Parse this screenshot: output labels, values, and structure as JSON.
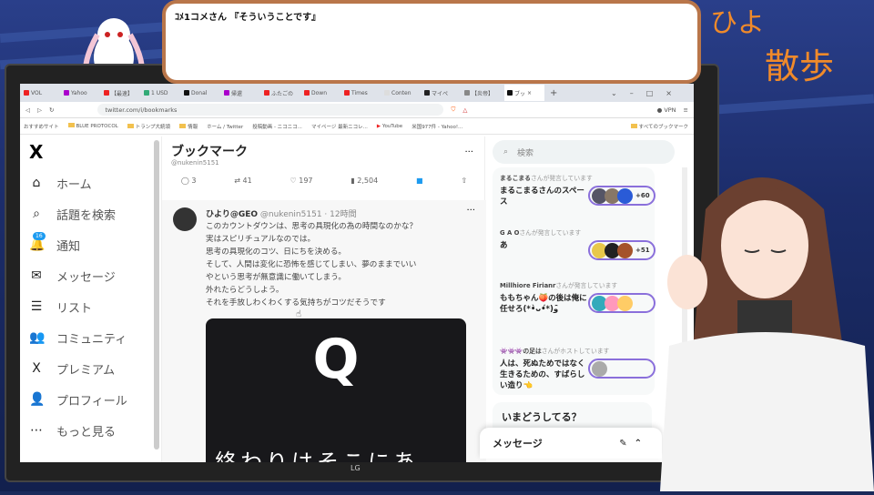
{
  "overlay": {
    "comment": "ｺﾒ1コメさん 『そういうことです』",
    "logo_line1": "ひよ",
    "logo_line2": "散歩",
    "monitor_brand": "LG"
  },
  "browser": {
    "tabs": [
      "VOL",
      "Yahoo",
      "【最速】",
      "1 USD",
      "Donal",
      "帰還",
      "ふたごの",
      "Down",
      "Times",
      "Conten",
      "マイペ",
      "【炎帝】",
      "ブッ"
    ],
    "new_tab": "+",
    "url": "twitter.com/i/bookmarks",
    "vpn": "VPN",
    "bookmarks": [
      "おすすめサイト",
      "BLUE PROTOCOL",
      "トランプ大統領",
      "情報",
      "ホーム / Twitter",
      "投稿動画 - ニコニコ...",
      "マイページ 最新ニコレ...",
      "YouTube",
      "米国977件 - Yahoo!...",
      "すべてのブックマーク"
    ]
  },
  "nav": {
    "logo": "X",
    "items": [
      {
        "label": "ホーム",
        "icon": "home-icon",
        "glyph": "⌂"
      },
      {
        "label": "話題を検索",
        "icon": "search-icon",
        "glyph": "⌕"
      },
      {
        "label": "通知",
        "icon": "bell-icon",
        "glyph": "🔔",
        "badge": "16"
      },
      {
        "label": "メッセージ",
        "icon": "mail-icon",
        "glyph": "✉"
      },
      {
        "label": "リスト",
        "icon": "list-icon",
        "glyph": "☰"
      },
      {
        "label": "コミュニティ",
        "icon": "community-icon",
        "glyph": "👥"
      },
      {
        "label": "プレミアム",
        "icon": "x-premium-icon",
        "glyph": "X"
      },
      {
        "label": "プロフィール",
        "icon": "profile-icon",
        "glyph": "👤"
      },
      {
        "label": "もっと見る",
        "icon": "more-icon",
        "glyph": "⋯"
      }
    ]
  },
  "bookmarks": {
    "title": "ブックマーク",
    "handle": "@nukenin5151",
    "more": "···",
    "prev_actions": {
      "replies": "3",
      "retweets": "41",
      "likes": "197",
      "views": "2,504"
    },
    "tweet": {
      "name": "ひより@GEO",
      "meta": "@nukenin5151 · 12時間",
      "more": "···",
      "text": "このカウントダウンは、思考の具現化の為の時間なのかな？\n実はスピリチュアルなのでは。\n思考の具現化のコツ、日にちを決める。\nそして、人間は変化に恐怖を感じてしまい、夢のままでいい\nやという思考が無意識に働いてしまう。\n外れたらどうしよう。\nそれを手放しわくわくする気持ちがコツだそうです",
      "card_letter": "Q",
      "card_text": "終わりはそこにあ"
    }
  },
  "sidebar": {
    "search_placeholder": "検索",
    "spaces": [
      {
        "host": "まるこまる",
        "host_suffix": "さんが発言しています",
        "title": "まるこまるさんのスペース",
        "count": "+60"
      },
      {
        "host": "G A O",
        "host_suffix": "さんが発言しています",
        "title": "あ",
        "count": "+51"
      },
      {
        "host": "Millhiore Firianr",
        "host_suffix": "さんが発言しています",
        "title": "ももちゃん🍑の後は俺に任せろ(*•̀ᴗ•́*)و ̑̑",
        "count": ""
      },
      {
        "host": "👾👾👾の足は",
        "host_suffix": "さんがホストしています",
        "title": "人は、死ぬためではなく生きるための、すばらしい造り👈",
        "count": ""
      }
    ],
    "whats_happening": "いまどうしてる？",
    "messages": "メッセージ"
  }
}
